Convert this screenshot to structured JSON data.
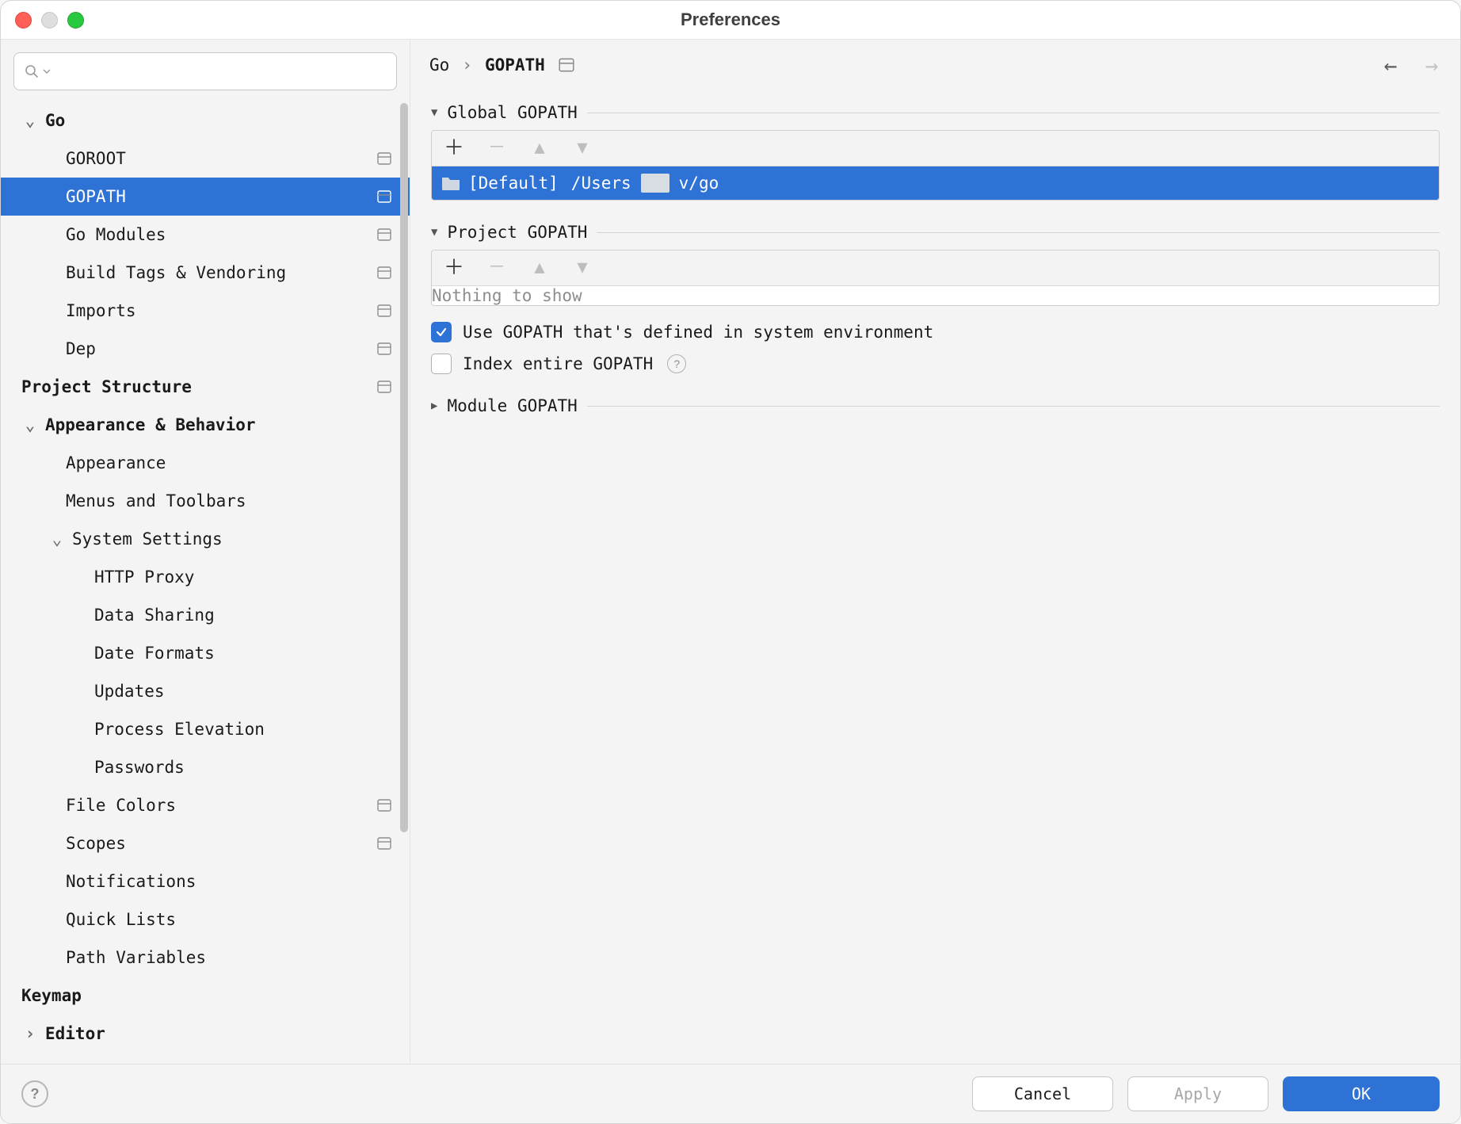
{
  "window": {
    "title": "Preferences"
  },
  "search": {
    "placeholder": ""
  },
  "sidebar": {
    "items": [
      {
        "label": "Go",
        "depth": 0,
        "bold": true,
        "expandable": true,
        "expanded": true
      },
      {
        "label": "GOROOT",
        "depth": 1,
        "scope": true
      },
      {
        "label": "GOPATH",
        "depth": 1,
        "scope": true,
        "selected": true
      },
      {
        "label": "Go Modules",
        "depth": 1,
        "scope": true
      },
      {
        "label": "Build Tags & Vendoring",
        "depth": 1,
        "scope": true
      },
      {
        "label": "Imports",
        "depth": 1,
        "scope": true
      },
      {
        "label": "Dep",
        "depth": 1,
        "scope": true
      },
      {
        "label": "Project Structure",
        "depth": 0,
        "bold": true,
        "scope": true
      },
      {
        "label": "Appearance & Behavior",
        "depth": 0,
        "bold": true,
        "expandable": true,
        "expanded": true
      },
      {
        "label": "Appearance",
        "depth": 1
      },
      {
        "label": "Menus and Toolbars",
        "depth": 1
      },
      {
        "label": "System Settings",
        "depth": 1,
        "expandable": true,
        "expanded": true
      },
      {
        "label": "HTTP Proxy",
        "depth": 2
      },
      {
        "label": "Data Sharing",
        "depth": 2
      },
      {
        "label": "Date Formats",
        "depth": 2
      },
      {
        "label": "Updates",
        "depth": 2
      },
      {
        "label": "Process Elevation",
        "depth": 2
      },
      {
        "label": "Passwords",
        "depth": 2
      },
      {
        "label": "File Colors",
        "depth": 1,
        "scope": true
      },
      {
        "label": "Scopes",
        "depth": 1,
        "scope": true
      },
      {
        "label": "Notifications",
        "depth": 1
      },
      {
        "label": "Quick Lists",
        "depth": 1
      },
      {
        "label": "Path Variables",
        "depth": 1
      },
      {
        "label": "Keymap",
        "depth": 0,
        "bold": true
      },
      {
        "label": "Editor",
        "depth": 0,
        "bold": true,
        "expandable": true,
        "expanded": false
      }
    ]
  },
  "breadcrumb": {
    "root": "Go",
    "current": "GOPATH"
  },
  "sections": {
    "global": {
      "title": "Global GOPATH",
      "row": {
        "default": "[Default]",
        "path_a": "/Users",
        "path_b": "v/go"
      }
    },
    "project": {
      "title": "Project GOPATH",
      "empty": "Nothing to show"
    },
    "module": {
      "title": "Module GOPATH"
    }
  },
  "checks": {
    "use_env": {
      "label": "Use GOPATH that's defined in system environment",
      "checked": true
    },
    "index": {
      "label": "Index entire GOPATH",
      "checked": false
    }
  },
  "footer": {
    "cancel": "Cancel",
    "apply": "Apply",
    "ok": "OK"
  }
}
